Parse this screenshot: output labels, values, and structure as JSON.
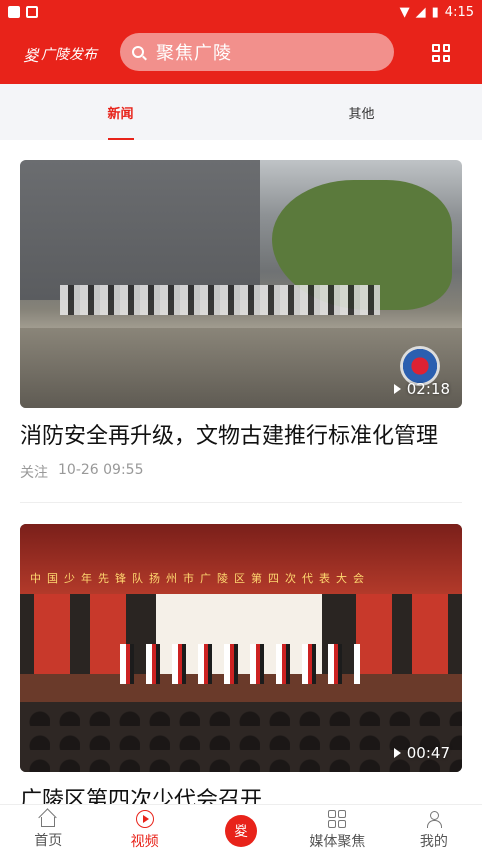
{
  "status_bar": {
    "time": "4:15"
  },
  "header": {
    "brand": "广陵发布",
    "search_placeholder": "聚焦广陵"
  },
  "tabs": [
    {
      "label": "新闻",
      "active": true
    },
    {
      "label": "其他",
      "active": false
    }
  ],
  "feed": [
    {
      "title": "消防安全再升级，文物古建推行标准化管理",
      "source": "关注",
      "time": "10-26 09:55",
      "duration": "02:18",
      "watermark": "扬州119"
    },
    {
      "title": "广陵区第四次少代会召开",
      "duration": "00:47",
      "banner": "中国少年先锋队扬州市广陵区第四次代表大会"
    }
  ],
  "bottom_nav": [
    {
      "label": "首页",
      "icon": "home-icon",
      "active": false
    },
    {
      "label": "视频",
      "icon": "video-icon",
      "active": true
    },
    {
      "label": "",
      "icon": "center-logo-icon",
      "active": false
    },
    {
      "label": "媒体聚焦",
      "icon": "grid-icon",
      "active": false
    },
    {
      "label": "我的",
      "icon": "user-icon",
      "active": false
    }
  ],
  "colors": {
    "accent": "#e8231a",
    "search_bg": "#f2908c",
    "tab_bg": "#f4f5f8"
  }
}
